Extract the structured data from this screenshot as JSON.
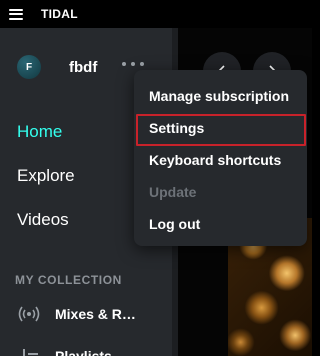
{
  "app": {
    "title": "TIDAL"
  },
  "profile": {
    "avatar_initial": "F",
    "username": "fbdf"
  },
  "sidebar": {
    "nav": [
      {
        "label": "Home",
        "active": true
      },
      {
        "label": "Explore",
        "active": false
      },
      {
        "label": "Videos",
        "active": false
      }
    ],
    "section_label": "MY COLLECTION",
    "collection": [
      {
        "label": "Mixes & R…",
        "icon": "radio-icon"
      },
      {
        "label": "Playlists",
        "icon": "playlist-icon"
      }
    ]
  },
  "menu": {
    "items": [
      {
        "label": "Manage subscription",
        "enabled": true
      },
      {
        "label": "Settings",
        "enabled": true,
        "highlighted": true
      },
      {
        "label": "Keyboard shortcuts",
        "enabled": true
      },
      {
        "label": "Update",
        "enabled": false
      },
      {
        "label": "Log out",
        "enabled": true
      }
    ]
  },
  "colors": {
    "accent": "#33ffee",
    "sidebar_bg": "#26292d",
    "highlight_border": "#c8222a",
    "disabled_text": "#6d7278"
  }
}
